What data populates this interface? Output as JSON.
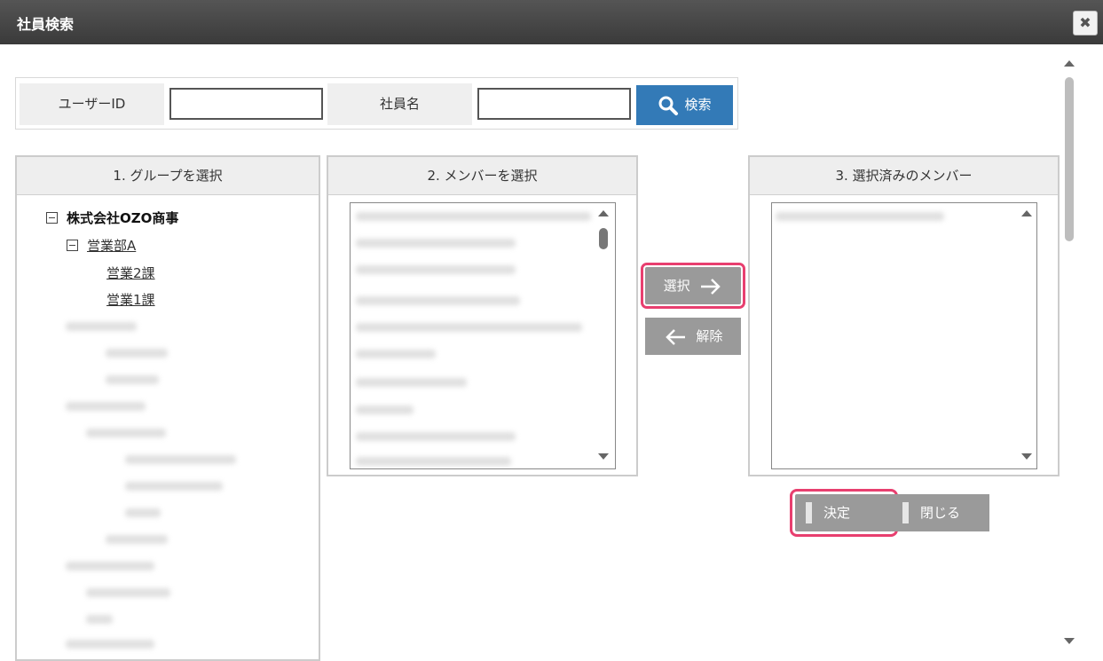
{
  "dialog": {
    "title": "社員検索",
    "close_symbol": "✖"
  },
  "search": {
    "user_id_label": "ユーザーID",
    "user_id_value": "",
    "name_label": "社員名",
    "name_value": "",
    "button_label": "検索"
  },
  "panels": {
    "group_header": "1. グループを選択",
    "member_header": "2. メンバーを選択",
    "selected_header": "3. 選択済みのメンバー"
  },
  "tree": [
    {
      "label": "株式会社OZO商事",
      "expanded": true,
      "root": true
    },
    {
      "label": "営業部A",
      "expanded": true
    },
    {
      "label": "営業2課"
    },
    {
      "label": "営業1課"
    }
  ],
  "actions": {
    "select_label": "選択",
    "release_label": "解除"
  },
  "footer": {
    "confirm_label": "決定",
    "close_label": "閉じる"
  },
  "colors": {
    "accent": "#337ab7",
    "highlight": "#e83f6f",
    "button_gray": "#9a9a9a"
  }
}
